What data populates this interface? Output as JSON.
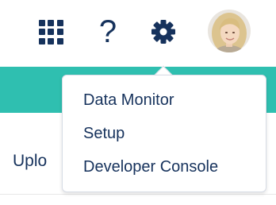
{
  "header": {
    "icons": [
      "app-launcher-icon",
      "help-icon",
      "setup-gear-icon",
      "user-avatar"
    ],
    "help_glyph": "?"
  },
  "page": {
    "title_partial": "Uplo"
  },
  "setup_menu": {
    "items": [
      {
        "label": "Data Monitor"
      },
      {
        "label": "Setup"
      },
      {
        "label": "Developer Console"
      }
    ]
  },
  "colors": {
    "icon": "#16325c",
    "teal_band": "#2fbfb0",
    "menu_text": "#16325c",
    "menu_border": "#d8dde6"
  }
}
